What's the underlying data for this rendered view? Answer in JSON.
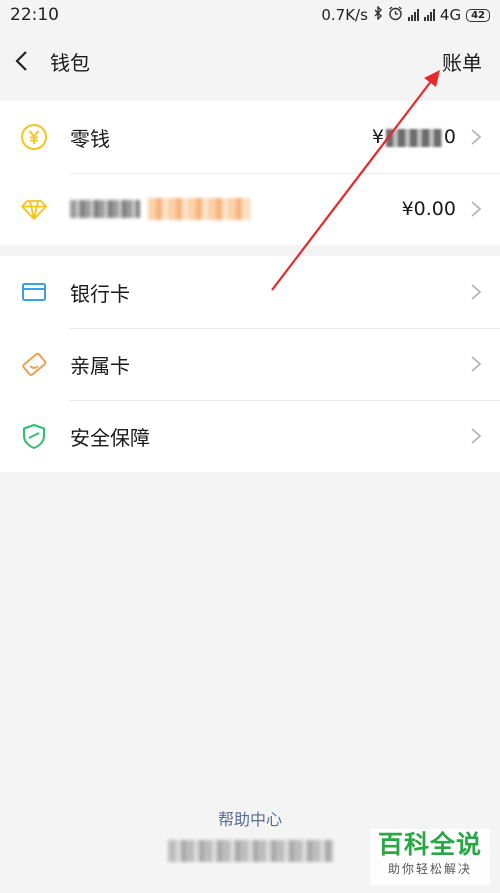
{
  "status_bar": {
    "time": "22:10",
    "speed": "0.7K/s",
    "network": "4G",
    "battery": "42"
  },
  "header": {
    "title": "钱包",
    "bill_label": "账单"
  },
  "wallet": {
    "items": [
      {
        "label": "零钱",
        "value_prefix": "¥",
        "value_suffix": "0",
        "icon": "yuan-coin-icon"
      },
      {
        "label": "",
        "value": "¥0.00",
        "icon": "diamond-icon"
      }
    ]
  },
  "services": {
    "items": [
      {
        "label": "银行卡",
        "icon": "bank-card-icon"
      },
      {
        "label": "亲属卡",
        "icon": "family-card-icon"
      },
      {
        "label": "安全保障",
        "icon": "shield-icon"
      }
    ]
  },
  "footer": {
    "help_label": "帮助中心"
  },
  "watermark": {
    "main": "百科全说",
    "sub": "助你轻松解决"
  },
  "colors": {
    "accent_yellow": "#f5c518",
    "bank_blue": "#3aa0e8",
    "family_orange": "#f0a04b",
    "shield_green": "#2cbf6e",
    "help_link": "#5b6d93",
    "arrow_red": "#e8292c"
  }
}
